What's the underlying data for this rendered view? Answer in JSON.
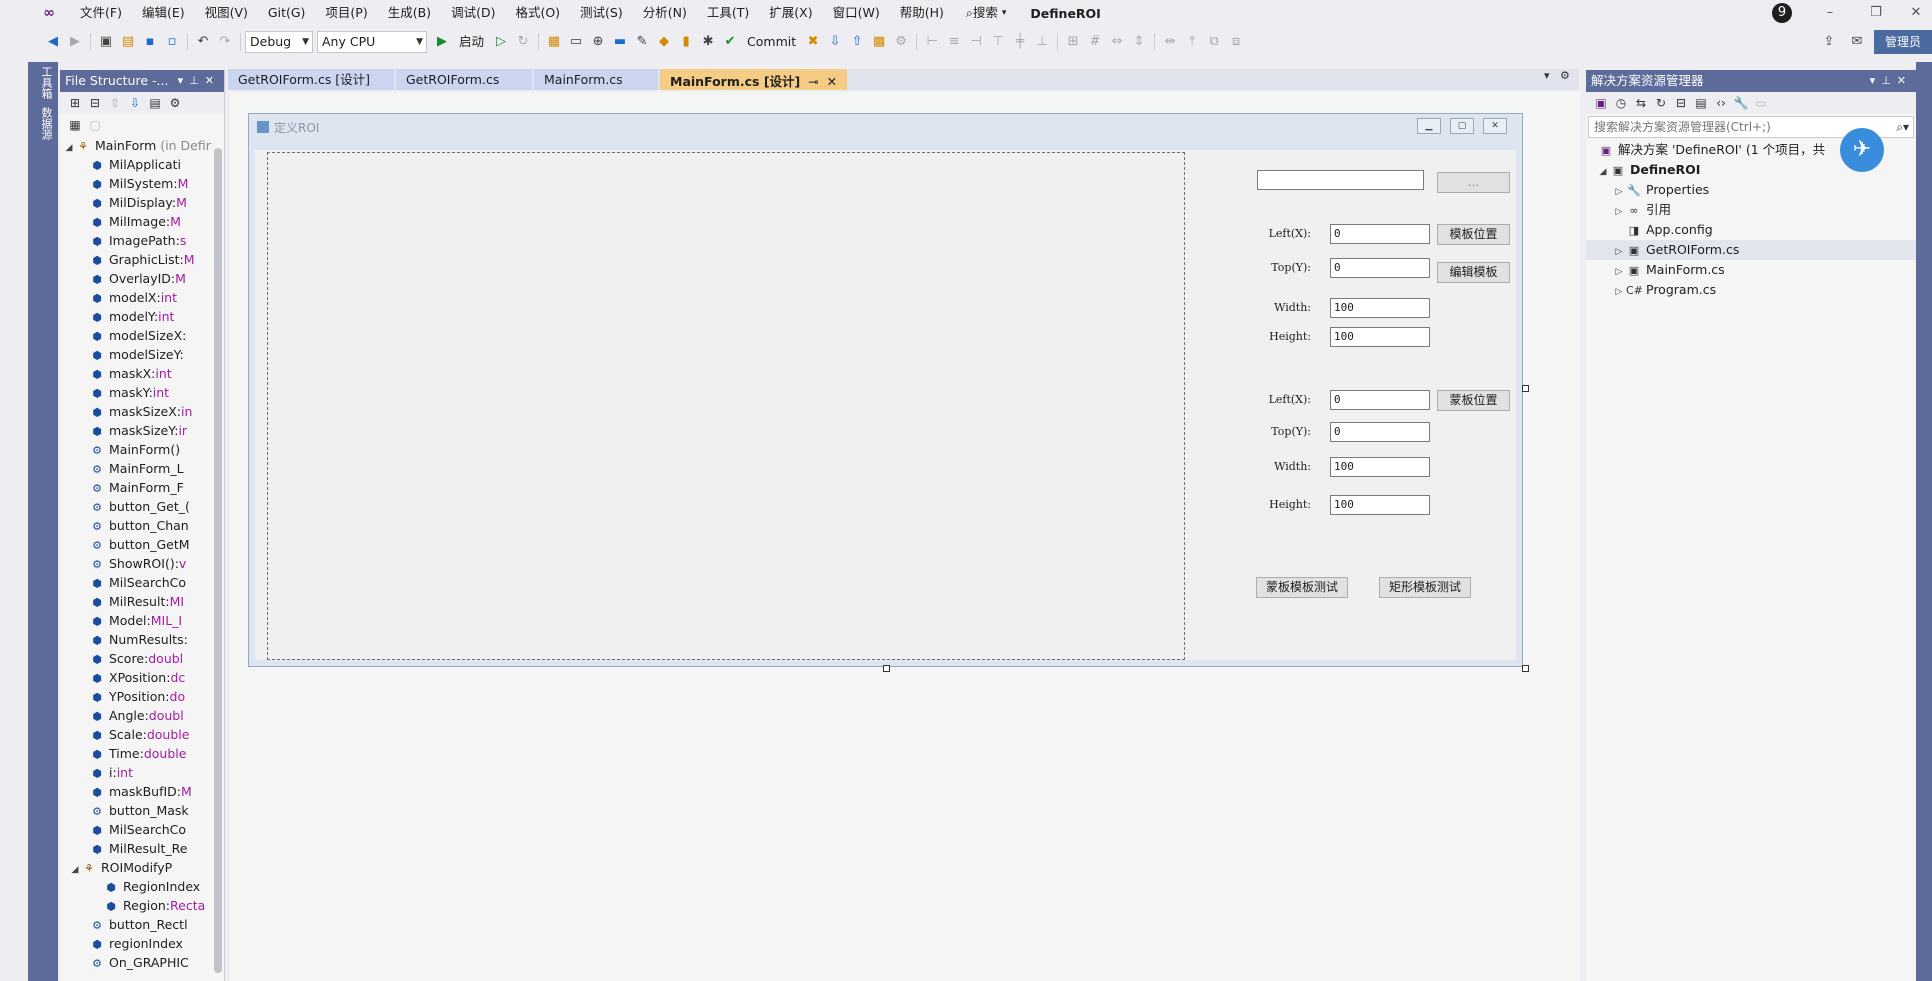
{
  "menubar": {
    "items": [
      "文件(F)",
      "编辑(E)",
      "视图(V)",
      "Git(G)",
      "项目(P)",
      "生成(B)",
      "调试(D)",
      "格式(O)",
      "测试(S)",
      "分析(N)",
      "工具(T)",
      "扩展(X)",
      "窗口(W)",
      "帮助(H)"
    ],
    "search": "搜索",
    "app_title": "DefineROI",
    "notifications": "9"
  },
  "toolbar": {
    "config": "Debug",
    "platform": "Any CPU",
    "start": "启动",
    "commit": "Commit",
    "admin": "管理员"
  },
  "left_strip": {
    "toolbox": "工具箱",
    "datasource": "数据源"
  },
  "file_structure": {
    "title": "File Structure -...",
    "root": {
      "name": "MainForm",
      "suffix": "(in Defir"
    },
    "members": [
      {
        "name": "MilApplicati",
        "type": ""
      },
      {
        "name": "MilSystem:",
        "type": "M"
      },
      {
        "name": "MilDisplay:",
        "type": "M"
      },
      {
        "name": "MilImage:",
        "type": "M"
      },
      {
        "name": "ImagePath:",
        "type": "s"
      },
      {
        "name": "GraphicList:",
        "type": "M"
      },
      {
        "name": "OverlayID:",
        "type": "M"
      },
      {
        "name": "modelX:",
        "type": "int"
      },
      {
        "name": "modelY:",
        "type": "int"
      },
      {
        "name": "modelSizeX:",
        "type": ""
      },
      {
        "name": "modelSizeY:",
        "type": ""
      },
      {
        "name": "maskX:",
        "type": "int"
      },
      {
        "name": "maskY:",
        "type": "int"
      },
      {
        "name": "maskSizeX:",
        "type": "in"
      },
      {
        "name": "maskSizeY:",
        "type": "ir"
      },
      {
        "name": "MainForm()",
        "type": ""
      },
      {
        "name": "MainForm_L",
        "type": ""
      },
      {
        "name": "MainForm_F",
        "type": ""
      },
      {
        "name": "button_Get_(",
        "type": ""
      },
      {
        "name": "button_Chan",
        "type": ""
      },
      {
        "name": "button_GetM",
        "type": ""
      },
      {
        "name": "ShowROI():",
        "type": "v"
      },
      {
        "name": "MilSearchCo",
        "type": ""
      },
      {
        "name": "MilResult:",
        "type": "MI"
      },
      {
        "name": "Model:",
        "type": "MIL_I"
      },
      {
        "name": "NumResults:",
        "type": ""
      },
      {
        "name": "Score:",
        "type": "doubl"
      },
      {
        "name": "XPosition:",
        "type": "dc"
      },
      {
        "name": "YPosition:",
        "type": "do"
      },
      {
        "name": "Angle:",
        "type": "doubl"
      },
      {
        "name": "Scale:",
        "type": "double"
      },
      {
        "name": "Time:",
        "type": "double"
      },
      {
        "name": "i:",
        "type": "int"
      },
      {
        "name": "maskBufID:",
        "type": "M"
      },
      {
        "name": "button_Mask",
        "type": ""
      },
      {
        "name": "MilSearchCo",
        "type": ""
      },
      {
        "name": "MilResult_Re",
        "type": ""
      },
      {
        "name": "ROIModifyP",
        "type": ""
      },
      {
        "name": "RegionIndex",
        "type": ""
      },
      {
        "name": "Region:",
        "type": "Recta"
      },
      {
        "name": "button_Rectl",
        "type": ""
      },
      {
        "name": "regionIndex",
        "type": ""
      },
      {
        "name": "On_GRAPHIC",
        "type": ""
      }
    ]
  },
  "doc_tabs": [
    "GetROIForm.cs [设计]",
    "GetROIForm.cs",
    "MainForm.cs",
    "MainForm.cs [设计]"
  ],
  "form": {
    "title": "定义ROI",
    "browse": "...",
    "path_value": "",
    "model": {
      "left_label": "Left(X):",
      "left": "0",
      "top_label": "Top(Y):",
      "top": "0",
      "width_label": "Width:",
      "width": "100",
      "height_label": "Height:",
      "height": "100",
      "pos_btn": "模板位置",
      "edit_btn": "编辑模板"
    },
    "mask": {
      "left_label": "Left(X):",
      "left": "0",
      "top_label": "Top(Y):",
      "top": "0",
      "width_label": "Width:",
      "width": "100",
      "height_label": "Height:",
      "height": "100",
      "pos_btn": "蒙板位置"
    },
    "test_mask_btn": "蒙板模板测试",
    "test_rect_btn": "矩形模板测试"
  },
  "solution_explorer": {
    "title": "解决方案资源管理器",
    "search_placeholder": "搜索解决方案资源管理器(Ctrl+;)",
    "solution": "解决方案 'DefineROI' (1 个项目，共",
    "project": "DefineROI",
    "items": [
      "Properties",
      "引用",
      "App.config",
      "GetROIForm.cs",
      "MainForm.cs",
      "Program.cs"
    ]
  },
  "colors": {
    "accent": "#5c6b99",
    "active_tab": "#f5cc84",
    "type_text": "#a31ca3"
  }
}
